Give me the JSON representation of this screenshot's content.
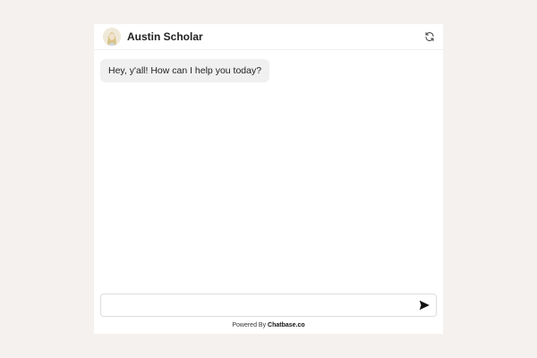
{
  "header": {
    "bot_name": "Austin Scholar",
    "avatar_icon": "avatar-illustration",
    "refresh_icon": "refresh-icon"
  },
  "messages": [
    {
      "role": "bot",
      "text": "Hey, y'all! How can I help you today?"
    }
  ],
  "composer": {
    "value": "",
    "placeholder": "",
    "send_icon": "send-icon"
  },
  "footer": {
    "powered_by": "Powered By",
    "brand": "Chatbase.co"
  },
  "colors": {
    "page_bg": "#f4f1ee",
    "widget_bg": "#ffffff",
    "bubble_bg": "#f0f0f0"
  }
}
